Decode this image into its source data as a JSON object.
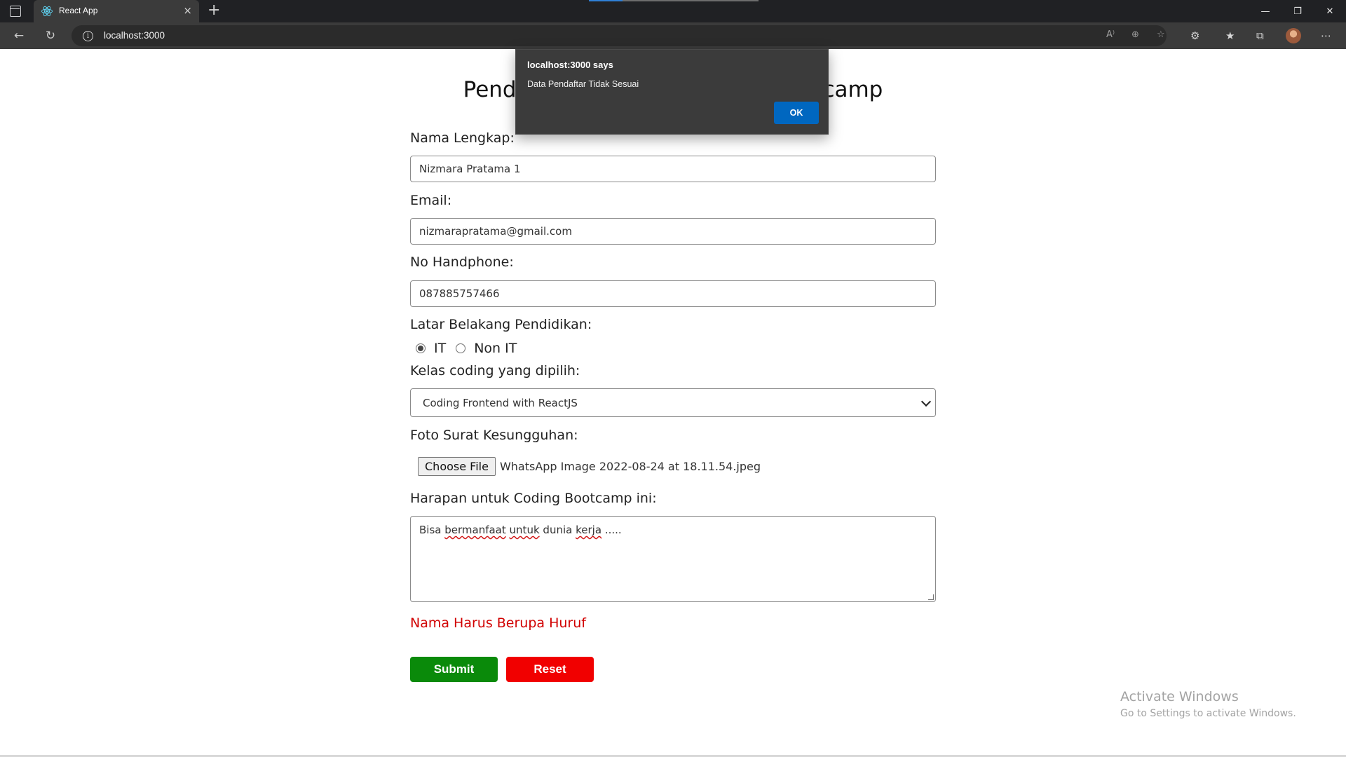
{
  "browser": {
    "tab_title": "React App",
    "tab_close": "×",
    "new_tab": "+",
    "url": "localhost:3000",
    "info": "i",
    "controls": {
      "minimize": "—",
      "restore": "❐",
      "close": "✕"
    },
    "nav": {
      "back": "←",
      "refresh": "↻"
    },
    "address_icons": {
      "read_aloud": "A⁾",
      "zoom": "⊕",
      "favorite_add": "☆"
    },
    "tool_icons": {
      "extensions": "⚙",
      "favorites": "★",
      "collections": "⧉",
      "more": "⋯"
    },
    "icon_names": [
      "tab-actions-icon",
      "react-logo-icon",
      "info-icon",
      "read-aloud-icon",
      "zoom-icon",
      "add-favorite-icon",
      "extensions-icon",
      "favorites-icon",
      "collections-icon",
      "more-icon"
    ]
  },
  "dialog": {
    "title": "localhost:3000 says",
    "message": "Data Pendaftar Tidak Sesuai",
    "ok_label": "OK"
  },
  "form": {
    "title": "Pendaftaran Peserta Coding Bootcamp",
    "name_label": "Nama Lengkap:",
    "name_value": "Nizmara Pratama 1",
    "email_label": "Email:",
    "email_value": "nizmarapratama@gmail.com",
    "phone_label": "No Handphone:",
    "phone_value": "087885757466",
    "education_label": "Latar Belakang Pendidikan:",
    "education_options": [
      {
        "label": "IT",
        "checked": true
      },
      {
        "label": "Non IT",
        "checked": false
      }
    ],
    "class_label": "Kelas coding yang dipilih:",
    "class_value": "Coding Frontend with ReactJS",
    "photo_label": "Foto Surat Kesungguhan:",
    "file_button": "Choose File",
    "file_name": "WhatsApp Image 2022-08-24 at 18.11.54.jpeg",
    "hope_label": "Harapan untuk Coding Bootcamp ini:",
    "hope_words": {
      "w1": "Bisa",
      "w2": "bermanfaat",
      "w3": "untuk",
      "w4": "dunia",
      "w5": "kerja",
      "w6": "....."
    },
    "error_message": "Nama Harus Berupa Huruf",
    "submit_label": "Submit",
    "reset_label": "Reset"
  },
  "watermark": {
    "title": "Activate Windows",
    "subtitle": "Go to Settings to activate Windows."
  },
  "colors": {
    "chrome_dark": "#202124",
    "toolbar": "#3b3b3b",
    "dialog_bg": "#3b3b3b",
    "ok_button": "#0067c0",
    "submit": "#0a8a0a",
    "reset": "#f10000",
    "error_text": "#d10000"
  }
}
